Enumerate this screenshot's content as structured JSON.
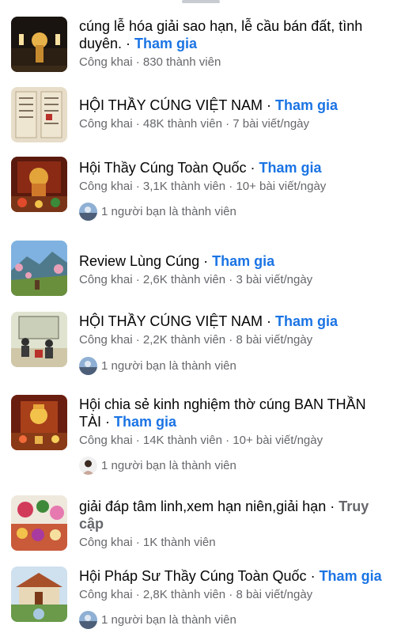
{
  "groups": [
    {
      "title": "cúng lễ hóa giải sao hạn, lễ cầu bán đất, tình duyên.",
      "action": "Tham gia",
      "meta": "Công khai · 830 thành viên"
    },
    {
      "title": "HỘI THẦY CÚNG VIỆT NAM",
      "action": "Tham gia",
      "meta": "Công khai · 48K thành viên · 7 bài viết/ngày"
    },
    {
      "title": "Hội Thầy Cúng Toàn Quốc",
      "action": "Tham gia",
      "meta": "Công khai · 3,1K thành viên · 10+ bài viết/ngày",
      "friend": "1 người bạn là thành viên"
    },
    {
      "title": "Review Lùng Cúng",
      "action": "Tham gia",
      "meta": "Công khai · 2,6K thành viên · 3 bài viết/ngày"
    },
    {
      "title": "HỘI THẦY CÚNG VIỆT NAM",
      "action": "Tham gia",
      "meta": "Công khai · 2,2K thành viên · 8 bài viết/ngày",
      "friend": "1 người bạn là thành viên"
    },
    {
      "title": "Hội chia sẻ kinh nghiệm thờ cúng BAN THẦN TÀI",
      "action": "Tham gia",
      "meta": "Công khai · 14K thành viên · 10+ bài viết/ngày",
      "friend": "1 người bạn là thành viên"
    },
    {
      "title": "giải đáp tâm linh,xem hạn niên,giải hạn",
      "action": "Truy cập",
      "meta": "Công khai · 1K thành viên"
    },
    {
      "title": "Hội Pháp Sư Thầy Cúng Toàn Quốc",
      "action": "Tham gia",
      "meta": "Công khai · 2,8K thành viên · 8 bài viết/ngày",
      "friend": "1 người bạn là thành viên"
    }
  ],
  "colors": {
    "link": "#1b74e4",
    "meta": "#65676b",
    "title": "#050505"
  }
}
